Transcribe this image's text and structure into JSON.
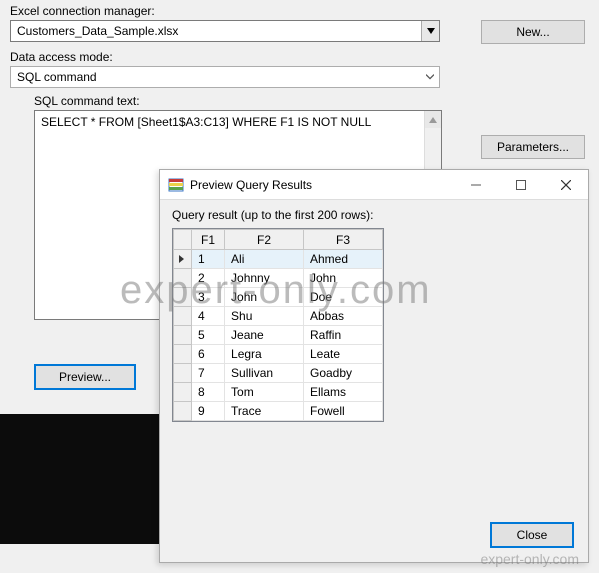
{
  "labels": {
    "excel_manager": "Excel connection manager:",
    "data_access": "Data access mode:",
    "sql_text": "SQL command text:"
  },
  "fields": {
    "excel_manager_value": "Customers_Data_Sample.xlsx",
    "data_access_value": "SQL command",
    "sql_command": "SELECT * FROM [Sheet1$A3:C13] WHERE F1 IS NOT NULL"
  },
  "buttons": {
    "new": "New...",
    "parameters": "Parameters...",
    "preview": "Preview...",
    "close": "Close"
  },
  "dialog": {
    "title": "Preview Query Results",
    "subtitle": "Query result (up to the first 200 rows):",
    "columns": [
      "F1",
      "F2",
      "F3"
    ],
    "rows": [
      [
        "1",
        "Ali",
        "Ahmed"
      ],
      [
        "2",
        "Johnny",
        "John"
      ],
      [
        "3",
        "John",
        "Doe"
      ],
      [
        "4",
        "Shu",
        "Abbas"
      ],
      [
        "5",
        "Jeane",
        "Raffin"
      ],
      [
        "6",
        "Legra",
        "Leate"
      ],
      [
        "7",
        "Sullivan",
        "Goadby"
      ],
      [
        "8",
        "Tom",
        "Ellams"
      ],
      [
        "9",
        "Trace",
        "Fowell"
      ]
    ]
  },
  "watermark": "expert-only.com"
}
